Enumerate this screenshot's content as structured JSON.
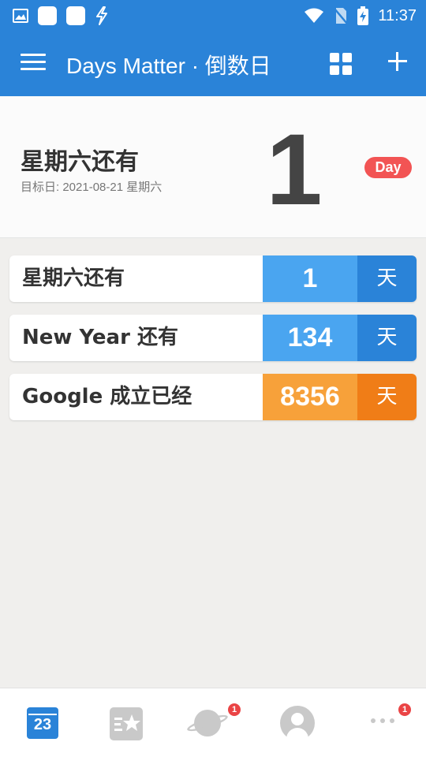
{
  "status_bar": {
    "time": "11:37",
    "icons": [
      "image-icon",
      "app-square-icon",
      "app-square-icon",
      "lightning-icon",
      "wifi-icon",
      "no-sim-icon",
      "battery-charging-icon"
    ]
  },
  "app_bar": {
    "title": "Days Matter · 倒数日",
    "icons": [
      "menu-icon",
      "grid-view-icon",
      "add-icon"
    ]
  },
  "hero": {
    "title": "星期六还有",
    "subtitle": "目标日: 2021-08-21 星期六",
    "count": "1",
    "badge": "Day"
  },
  "events": [
    {
      "title": "星期六还有",
      "count": "1",
      "unit": "天",
      "color": "#4aa5f0",
      "unit_color": "#2a83d8"
    },
    {
      "title": "New Year 还有",
      "count": "134",
      "unit": "天",
      "color": "#4aa5f0",
      "unit_color": "#2a83d8"
    },
    {
      "title": "Google 成立已经",
      "count": "8356",
      "unit": "天",
      "color": "#f7a13a",
      "unit_color": "#f07d17"
    }
  ],
  "bottom_nav": {
    "calendar_label": "23",
    "planet_badge": "1",
    "more_badge": "1"
  },
  "colors": {
    "primary": "#2a83d8",
    "badge_red": "#f25454",
    "inactive": "#c9c9c9"
  }
}
